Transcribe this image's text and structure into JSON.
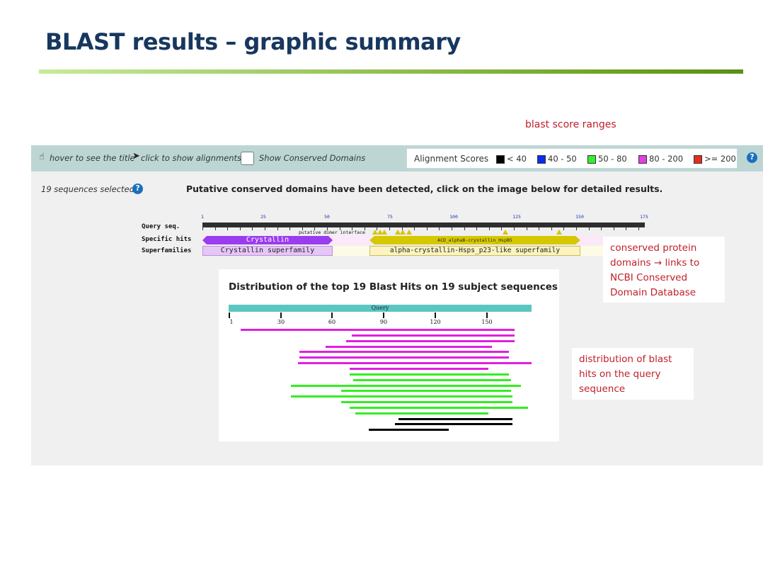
{
  "slide": {
    "title": "BLAST results – graphic summary"
  },
  "annotations": {
    "score_ranges": "blast score ranges",
    "conserved_domains": "conserved protein domains → links to NCBI Conserved Domain Database",
    "distribution": "distribution of blast hits on the query sequence"
  },
  "toolbar": {
    "hover_hint": "hover to see the title",
    "click_hint": "click to show alignments",
    "show_cdd_label": "Show Conserved Domains",
    "show_cdd_checked": false,
    "scores_title": "Alignment Scores",
    "score_ranges": [
      {
        "label": "< 40",
        "color": "#000000"
      },
      {
        "label": "40 - 50",
        "color": "#0a2cf0"
      },
      {
        "label": "50 - 80",
        "color": "#33ee33"
      },
      {
        "label": "80 - 200",
        "color": "#e040e0"
      },
      {
        "label": ">= 200",
        "color": "#e03020"
      }
    ]
  },
  "summary": {
    "selected": "19 sequences selected",
    "help_glyph": "?",
    "detected_message": "Putative conserved domains have been detected, click on the image below for detailed results."
  },
  "cdd": {
    "row_labels": [
      "Query seq.",
      "Specific hits",
      "Superfamilies"
    ],
    "ruler_ticks": [
      "1",
      "25",
      "50",
      "75",
      "100",
      "125",
      "150",
      "175"
    ],
    "dimer_label": "putative dimer interface",
    "specific_hits": [
      {
        "label": "Crystallin",
        "color": "#9b3cf0"
      },
      {
        "label": "ACD_alphaB-crystallin_HspB5",
        "color": "#d6c800"
      }
    ],
    "superfamilies": [
      {
        "label": "Crystallin superfamily"
      },
      {
        "label": "alpha-crystallin-Hsps_p23-like superfamily"
      }
    ]
  },
  "distribution": {
    "title": "Distribution of the top 19 Blast Hits on 19 subject sequences",
    "query_label": "Query",
    "query_length": 175,
    "ticks": [
      "1",
      "30",
      "60",
      "90",
      "120",
      "150"
    ],
    "colors": {
      "magenta": "#e020e0",
      "green": "#33ee22",
      "black": "#000000"
    },
    "hits": [
      {
        "start": 8,
        "end": 165,
        "score": "80 - 200"
      },
      {
        "start": 72,
        "end": 165,
        "score": "80 - 200"
      },
      {
        "start": 69,
        "end": 165,
        "score": "80 - 200"
      },
      {
        "start": 57,
        "end": 152,
        "score": "80 - 200"
      },
      {
        "start": 42,
        "end": 162,
        "score": "80 - 200"
      },
      {
        "start": 42,
        "end": 162,
        "score": "80 - 200"
      },
      {
        "start": 41,
        "end": 175,
        "score": "80 - 200"
      },
      {
        "start": 71,
        "end": 150,
        "score": "80 - 200"
      },
      {
        "start": 71,
        "end": 162,
        "score": "50 - 80"
      },
      {
        "start": 73,
        "end": 163,
        "score": "50 - 80"
      },
      {
        "start": 37,
        "end": 169,
        "score": "50 - 80"
      },
      {
        "start": 66,
        "end": 163,
        "score": "50 - 80"
      },
      {
        "start": 37,
        "end": 164,
        "score": "50 - 80"
      },
      {
        "start": 66,
        "end": 164,
        "score": "50 - 80"
      },
      {
        "start": 71,
        "end": 173,
        "score": "50 - 80"
      },
      {
        "start": 74,
        "end": 150,
        "score": "50 - 80"
      },
      {
        "start": 99,
        "end": 164,
        "score": "< 40"
      },
      {
        "start": 97,
        "end": 164,
        "score": "< 40"
      },
      {
        "start": 82,
        "end": 127,
        "score": "< 40"
      }
    ]
  }
}
